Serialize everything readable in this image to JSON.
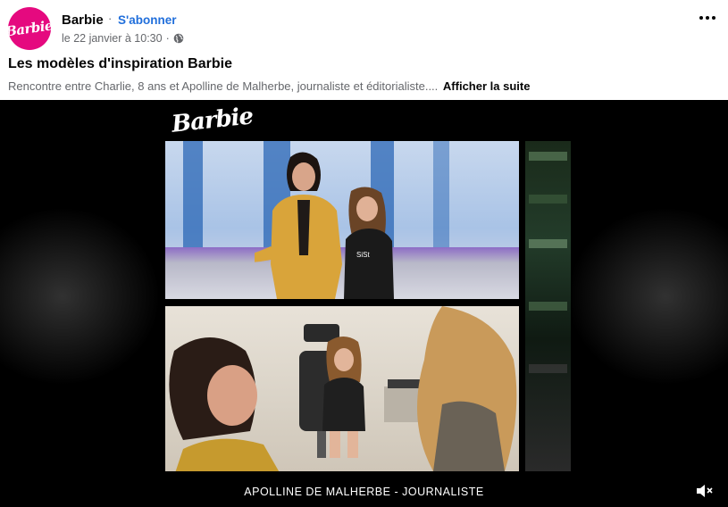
{
  "header": {
    "page_name": "Barbie",
    "dot": "·",
    "subscribe_label": "S'abonner",
    "timestamp": "le 22 janvier à 10:30",
    "meta_sep": "·",
    "avatar_icon": "barbie-logo",
    "privacy_icon": "globe-icon",
    "more_icon": "more-options-icon"
  },
  "post": {
    "title": "Les modèles d'inspiration Barbie",
    "description": "Rencontre entre Charlie, 8 ans et Apolline de Malherbe, journaliste et éditorialiste....",
    "see_more_label": "Afficher la suite"
  },
  "video": {
    "brand_logo": "Barbie",
    "caption": "APOLLINE DE MALHERBE - JOURNALISTE",
    "mute_icon": "volume-muted-icon"
  },
  "colors": {
    "accent": "#216fdb",
    "brand": "#e5097f",
    "text_primary": "#050505",
    "text_secondary": "#65676b"
  }
}
